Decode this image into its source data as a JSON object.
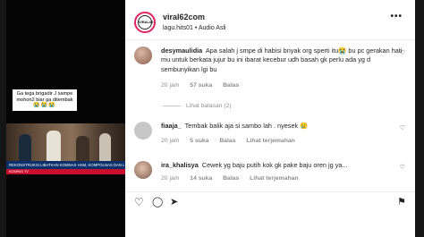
{
  "video": {
    "caption": "Ga tega brigadir J sampe mohon2 biar ga ditembak",
    "caption_emoji": "😭😭😭",
    "news_headline": "REKONSTRUKSI LIBATKAN KOMNAS HAM, KOMPOLNAS DAN LPSK",
    "ticker_text": "KOMPAS TV"
  },
  "header": {
    "username": "viral62com",
    "avatar_text": "VIRAL62",
    "audio_prefix": "lagu.hits01",
    "separator": "•",
    "audio_label": "Audio Asli",
    "more_label": "•••"
  },
  "comments": [
    {
      "username": "desymaulidia",
      "text": "Apa salah j smpe di habisi bnyak org sperti itu😭 bu pc gerakan hati mu untuk berkata jujur bu ini ibarat kecebur udh basah gk perlu ada yg d sembunyikan lgi bu",
      "time": "20 jam",
      "likes": "57 suka",
      "reply": "Balas",
      "replies_label": "Lihat balasan (2)"
    },
    {
      "username": "fiaaja_",
      "text": "Tembak balik aja si sambo lah . nyesek 😢",
      "time": "20 jam",
      "likes": "5 suka",
      "reply": "Balas",
      "translate": "Lihat terjemahan"
    },
    {
      "username": "ira_khalisya",
      "text": "Cewek yg baju putih kok gk pake baju oren jg ya...",
      "time": "20 jam",
      "likes": "14 suka",
      "reply": "Balas",
      "translate": "Lihat terjemahan"
    }
  ],
  "icons": {
    "heart": "♡",
    "like": "♡",
    "comment": "◯",
    "share": "➤",
    "bookmark": "⚑"
  }
}
